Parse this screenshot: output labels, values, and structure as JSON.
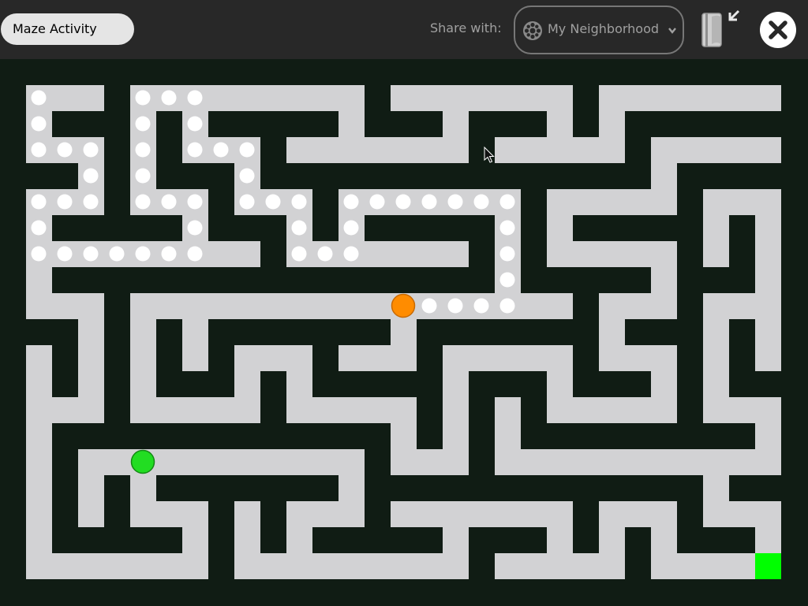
{
  "toolbar": {
    "activity_name": "Maze Activity",
    "share_label": "Share with:",
    "share_value": "My Neighborhood",
    "icons": [
      "neighborhood-globe-icon",
      "dropdown-chevron-icon",
      "journal-keep-icon",
      "stop-icon"
    ]
  },
  "maze": {
    "colors": {
      "wall": "#101c14",
      "floor": "#d2d2d4",
      "trail": "#ffffff",
      "player_orange": "#ff8c00",
      "player_green": "#22dd22",
      "goal": "#00ff00"
    },
    "grid_columns": 31,
    "grid_rows": 21
  }
}
